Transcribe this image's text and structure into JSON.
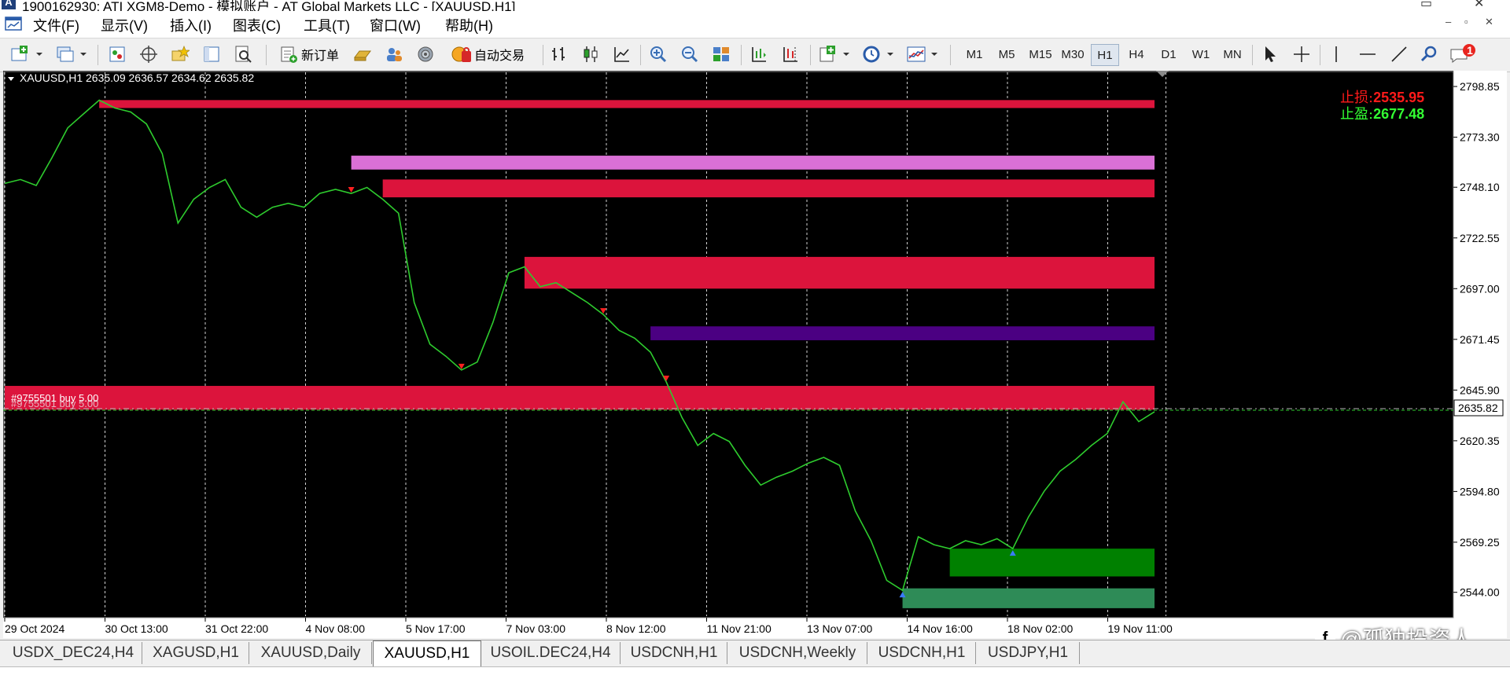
{
  "window": {
    "title": "1900162930: ATI XGM8-Demo - 模拟账户 - AT Global Markets LLC - [XAUUSD,H1]",
    "icon": "app-icon"
  },
  "menu": {
    "items": [
      "文件(F)",
      "显示(V)",
      "插入(I)",
      "图表(C)",
      "工具(T)",
      "窗口(W)",
      "帮助(H)"
    ]
  },
  "toolbar": {
    "new_order_label": "新订单",
    "auto_trade_label": "自动交易",
    "timeframes": [
      "M1",
      "M5",
      "M15",
      "M30",
      "H1",
      "H4",
      "D1",
      "W1",
      "MN"
    ],
    "active_timeframe": "H1",
    "notification_count": "1"
  },
  "chart": {
    "header": "XAUUSD,H1  2635.09 2636.57 2634.62 2635.82",
    "stop_loss_label": "止损:",
    "stop_loss_value": "2535.95",
    "take_profit_label": "止盈:",
    "take_profit_value": "2677.48",
    "order_label": "#9755501 buy 5.00",
    "current_price": "2635.82",
    "colors": {
      "background": "#000000",
      "candle": "#2ecc2e",
      "supply_zone": "#dc143c",
      "pink_zone": "#da70d6",
      "purple_zone": "#4b0082",
      "demand_zone": "#008000",
      "demand_zone_light": "#2e8b57",
      "stop_loss_text": "#ff1a1a",
      "take_profit_text": "#33ff33"
    }
  },
  "chart_data": {
    "type": "line",
    "symbol": "XAUUSD",
    "timeframe": "H1",
    "y_ticks": [
      2798.85,
      2773.3,
      2748.1,
      2722.55,
      2697.0,
      2671.45,
      2645.9,
      2620.35,
      2594.8,
      2569.25,
      2544.0
    ],
    "x_ticks": [
      "29 Oct 2024",
      "30 Oct 13:00",
      "31 Oct 22:00",
      "4 Nov 08:00",
      "5 Nov 17:00",
      "7 Nov 03:00",
      "8 Nov 12:00",
      "11 Nov 21:00",
      "13 Nov 07:00",
      "14 Nov 16:00",
      "18 Nov 02:00",
      "19 Nov 11:00"
    ],
    "ylim": [
      2532,
      2806
    ],
    "price_path": [
      2750,
      2752,
      2749,
      2763,
      2778,
      2785,
      2792,
      2788,
      2786,
      2780,
      2765,
      2730,
      2742,
      2748,
      2752,
      2738,
      2733,
      2738,
      2740,
      2738,
      2745,
      2747,
      2745,
      2748,
      2742,
      2735,
      2690,
      2669,
      2663,
      2656,
      2660,
      2680,
      2705,
      2708,
      2698,
      2700,
      2695,
      2690,
      2684,
      2676,
      2672,
      2665,
      2650,
      2632,
      2618,
      2624,
      2620,
      2608,
      2598,
      2602,
      2605,
      2609,
      2612,
      2608,
      2585,
      2570,
      2550,
      2545,
      2572,
      2568,
      2566,
      2570,
      2568,
      2571,
      2566,
      2582,
      2595,
      2605,
      2611,
      2618,
      2624,
      2640,
      2630,
      2635
    ],
    "zones": [
      {
        "kind": "supply",
        "from": 2792,
        "to": 2788
      },
      {
        "kind": "pink",
        "from": 2764,
        "to": 2757
      },
      {
        "kind": "supply",
        "from": 2752,
        "to": 2743
      },
      {
        "kind": "supply",
        "from": 2713,
        "to": 2697
      },
      {
        "kind": "purple",
        "from": 2678,
        "to": 2671
      },
      {
        "kind": "supply",
        "from": 2648,
        "to": 2636
      },
      {
        "kind": "demand",
        "from": 2566,
        "to": 2552
      },
      {
        "kind": "demand_light",
        "from": 2546,
        "to": 2536
      }
    ]
  },
  "tabs": {
    "items": [
      "USDX_DEC24,H4",
      "XAGUSD,H1",
      "XAUUSD,Daily",
      "XAUUSD,H1",
      "USOIL.DEC24,H4",
      "USDCNH,H1",
      "USDCNH,Weekly",
      "USDCNH,H1",
      "USDJPY,H1"
    ],
    "active": "XAUUSD,H1"
  },
  "watermark": {
    "text": "@孤独投资人"
  }
}
